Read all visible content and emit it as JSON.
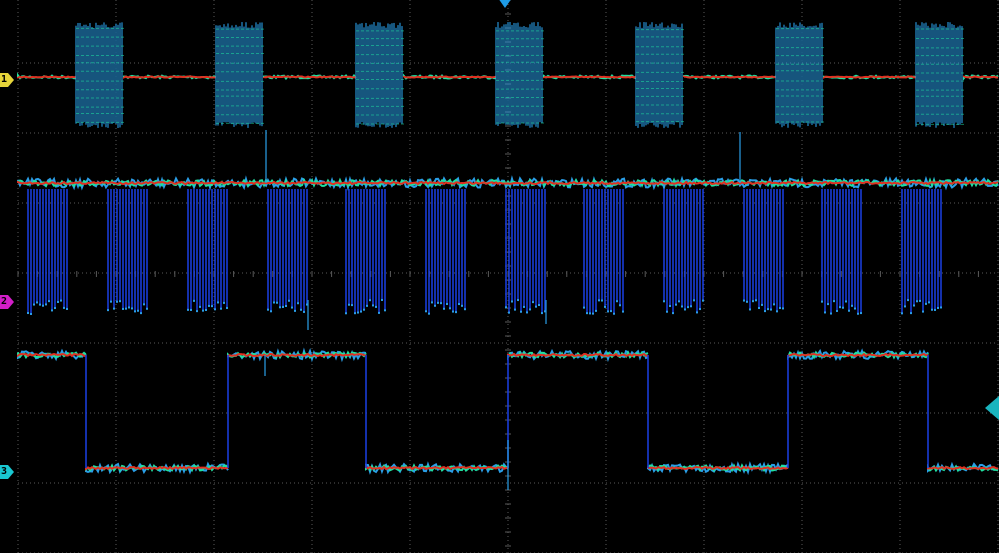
{
  "scope": {
    "grid_divisions": {
      "horizontal": 10,
      "vertical": 8
    },
    "colors": {
      "grid": "#5a5a5a",
      "ch1": "#e6d43a",
      "ch2": "#d21ec8",
      "ch3": "#19c8d2",
      "trigger_position": "#1e9be6",
      "trigger_level": "#19b4be",
      "trace_core": "#2a9fe8",
      "trace_dense": "#1fe0a0",
      "trace_hot": "#e03020",
      "trace_deep": "#1a3cd8"
    },
    "channels": [
      {
        "id": "ch1",
        "label": "1"
      },
      {
        "id": "ch2",
        "label": "2"
      },
      {
        "id": "ch3",
        "label": "3"
      }
    ],
    "icons": {
      "trigger_position": "trigger-position-icon",
      "trigger_level": "trigger-level-icon"
    }
  }
}
